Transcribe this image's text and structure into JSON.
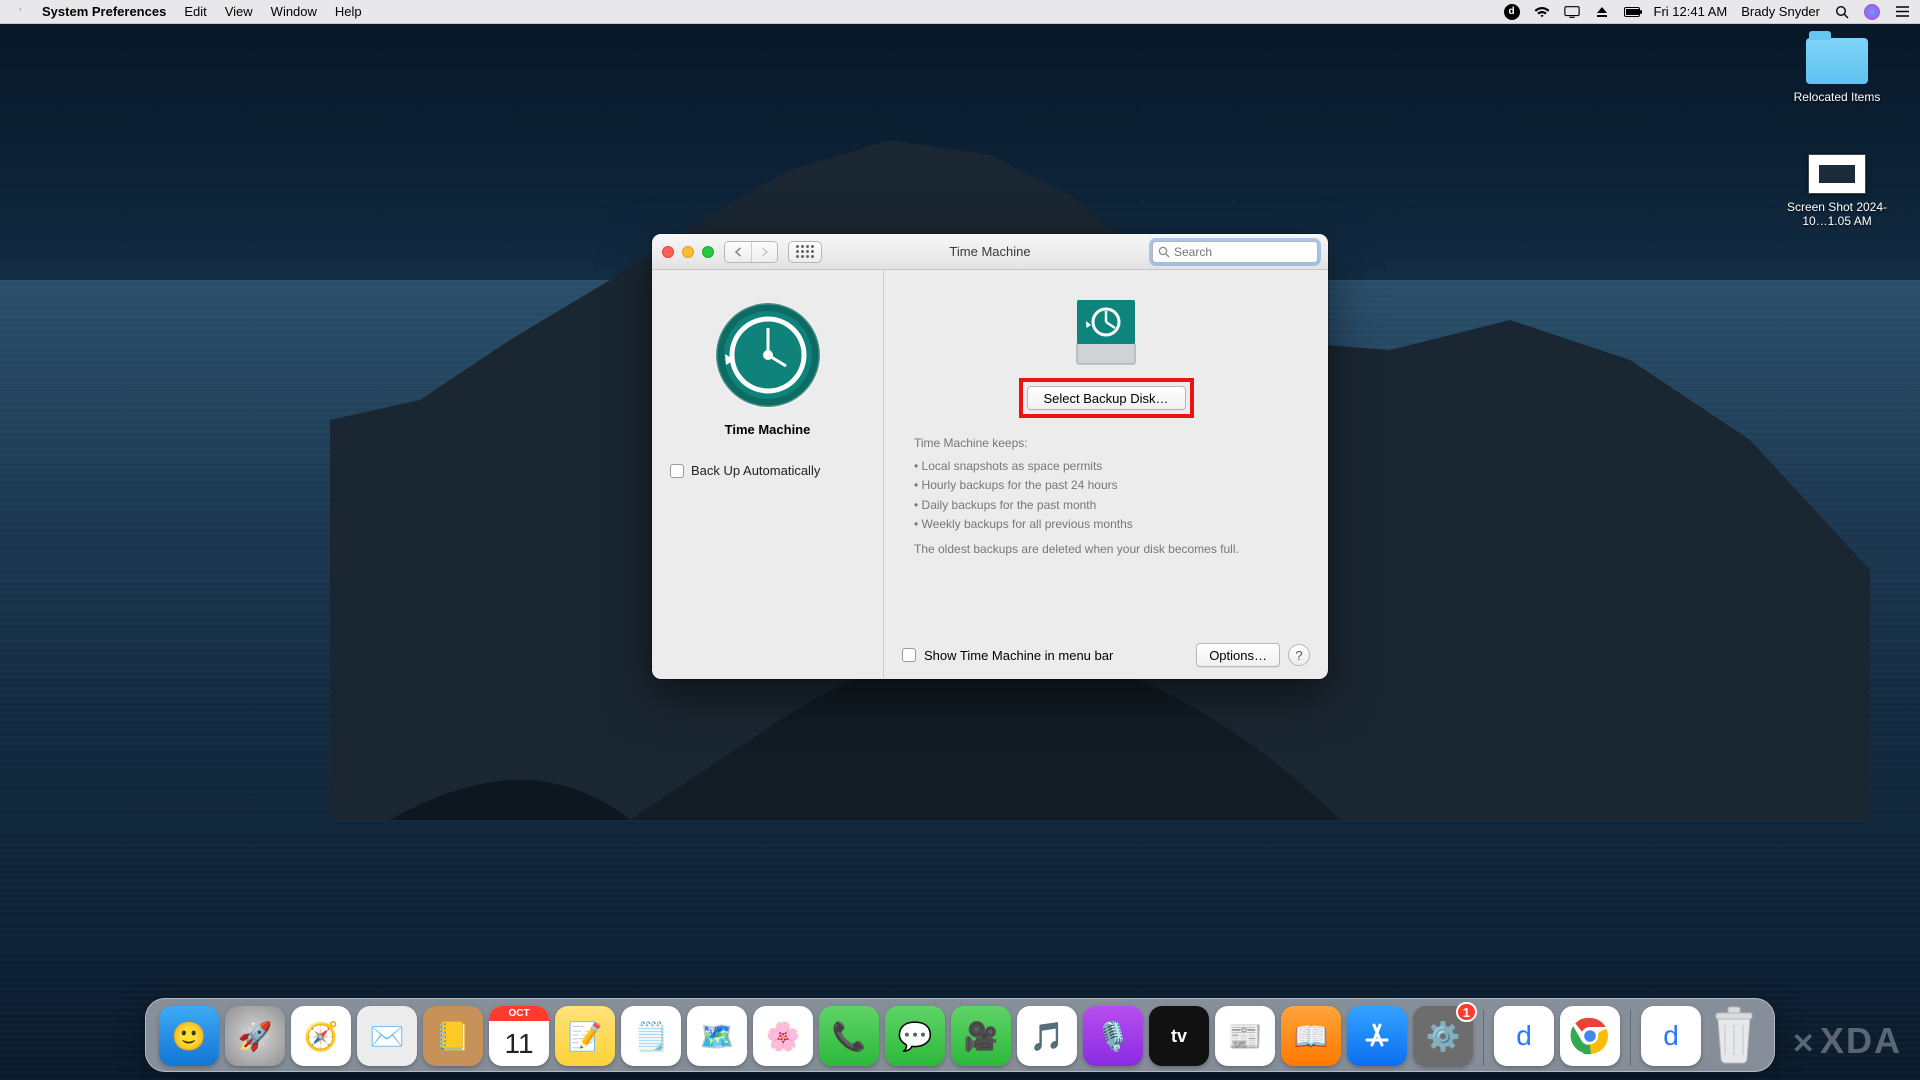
{
  "menubar": {
    "app_name": "System Preferences",
    "items": [
      "Edit",
      "View",
      "Window",
      "Help"
    ],
    "clock": "Fri 12:41 AM",
    "user": "Brady Snyder"
  },
  "desktop": {
    "folder_label": "Relocated Items",
    "screenshot_label": "Screen Shot 2024-10…1.05 AM"
  },
  "window": {
    "title": "Time Machine",
    "search_placeholder": "Search",
    "tm_label": "Time Machine",
    "backup_auto_label": "Back Up Automatically",
    "select_disk_label": "Select Backup Disk…",
    "keeps_header": "Time Machine keeps:",
    "keeps_items": [
      "Local snapshots as space permits",
      "Hourly backups for the past 24 hours",
      "Daily backups for the past month",
      "Weekly backups for all previous months"
    ],
    "oldest_note": "The oldest backups are deleted when your disk becomes full.",
    "show_menubar_label": "Show Time Machine in menu bar",
    "options_label": "Options…",
    "help_label": "?"
  },
  "dock": {
    "items": [
      {
        "name": "finder",
        "bg": "linear-gradient(#3fa9f5,#1276d4)",
        "glyph": "🙂"
      },
      {
        "name": "launchpad",
        "bg": "radial-gradient(circle,#d9d9d9,#8f8f8f)",
        "glyph": "🚀"
      },
      {
        "name": "safari",
        "bg": "#fff",
        "glyph": "🧭"
      },
      {
        "name": "mail",
        "bg": "#ececec",
        "glyph": "✉️"
      },
      {
        "name": "contacts",
        "bg": "#c7925a",
        "glyph": "📒"
      },
      {
        "name": "calendar",
        "bg": "#fff",
        "glyph": "📅",
        "sub": "11",
        "top": "OCT"
      },
      {
        "name": "notes",
        "bg": "linear-gradient(#ffe27a,#ffd23a)",
        "glyph": "📝"
      },
      {
        "name": "reminders",
        "bg": "#fff",
        "glyph": "🗒️"
      },
      {
        "name": "maps",
        "bg": "#fff",
        "glyph": "🗺️"
      },
      {
        "name": "photos",
        "bg": "#fff",
        "glyph": "🌸"
      },
      {
        "name": "facetime-audio",
        "bg": "linear-gradient(#5fd368,#2db93a)",
        "glyph": "📞"
      },
      {
        "name": "messages",
        "bg": "linear-gradient(#5fd368,#2db93a)",
        "glyph": "💬"
      },
      {
        "name": "facetime",
        "bg": "linear-gradient(#5fd368,#2db93a)",
        "glyph": "🎥"
      },
      {
        "name": "music",
        "bg": "#fff",
        "glyph": "🎵"
      },
      {
        "name": "podcasts",
        "bg": "linear-gradient(#b84ef0,#8a2be2)",
        "glyph": "🎙️"
      },
      {
        "name": "tv",
        "bg": "#111",
        "glyph": "tv"
      },
      {
        "name": "news",
        "bg": "#fff",
        "glyph": "📰"
      },
      {
        "name": "books",
        "bg": "linear-gradient(#ffa339,#ff7a00)",
        "glyph": "📖"
      },
      {
        "name": "appstore",
        "bg": "linear-gradient(#35a2ff,#0a6ff0)",
        "glyph": "A"
      },
      {
        "name": "system-preferences",
        "bg": "#6d6d6d",
        "glyph": "⚙️",
        "badge": "1"
      }
    ],
    "right_items": [
      {
        "name": "app-d",
        "bg": "#fff",
        "glyph": "d",
        "color": "#2b74ff"
      },
      {
        "name": "chrome",
        "bg": "#fff",
        "glyph": "◯"
      },
      {
        "name": "app-d2",
        "bg": "#fff",
        "glyph": "d",
        "color": "#2b74ff"
      }
    ]
  },
  "watermark": "XDA"
}
